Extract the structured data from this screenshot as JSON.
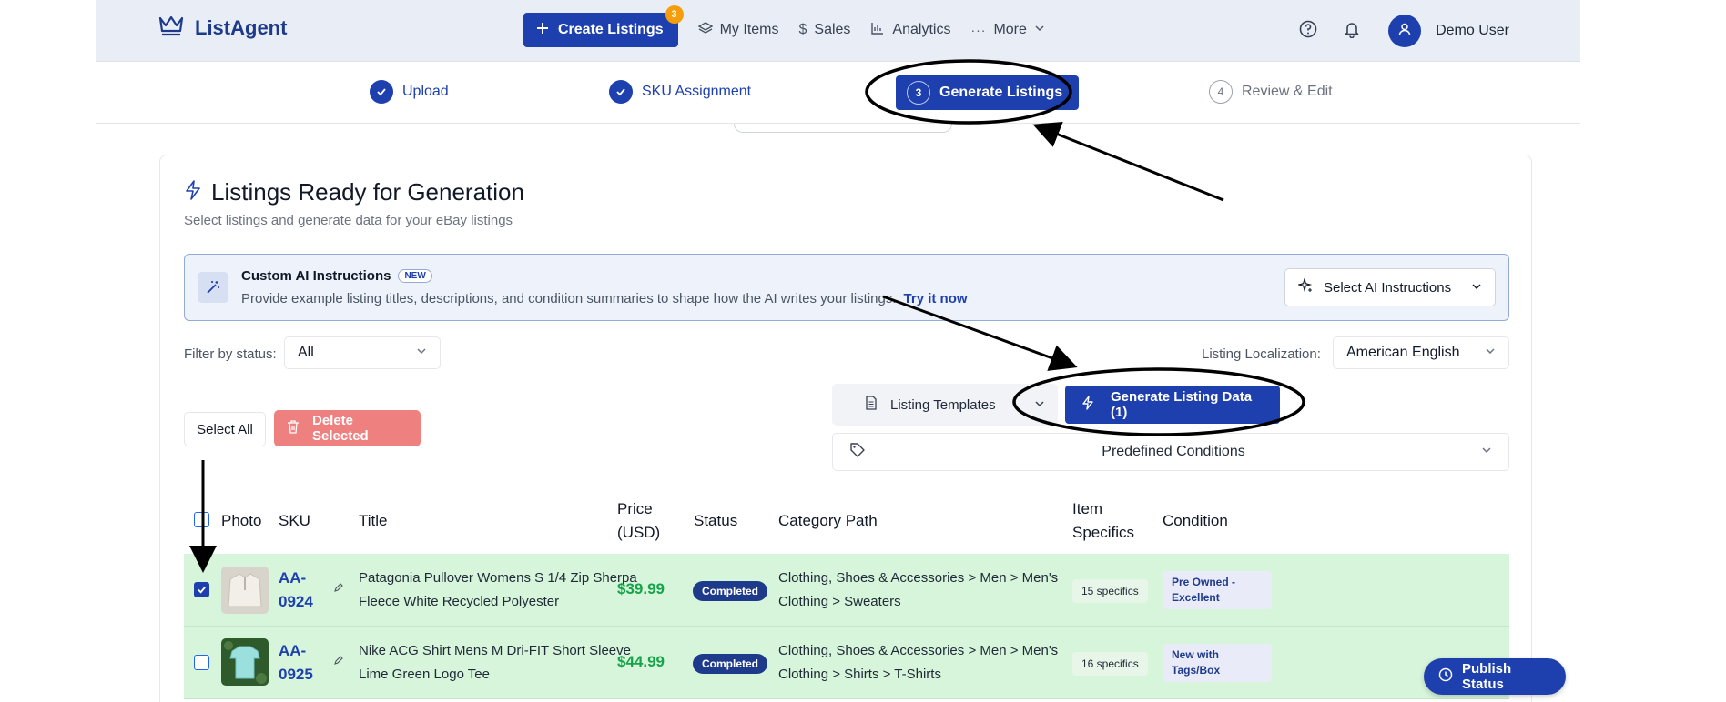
{
  "nav": {
    "brand": "ListAgent",
    "create_label": "Create Listings",
    "create_badge": "3",
    "links": [
      "My Items",
      "Sales",
      "Analytics",
      "More"
    ],
    "user": "Demo User"
  },
  "steps": [
    {
      "num": "",
      "label": "Upload",
      "state": "done"
    },
    {
      "num": "",
      "label": "SKU Assignment",
      "state": "done"
    },
    {
      "num": "3",
      "label": "Generate Listings",
      "state": "active"
    },
    {
      "num": "4",
      "label": "Review & Edit",
      "state": "todo"
    }
  ],
  "page": {
    "title": "Listings Ready for Generation",
    "subtitle": "Select listings and generate data for your eBay listings"
  },
  "ai": {
    "title": "Custom AI Instructions",
    "badge": "NEW",
    "description": "Provide example listing titles, descriptions, and condition summaries to shape how the AI writes your listings.",
    "try_link": "Try it now",
    "select_label": "Select AI Instructions"
  },
  "filters": {
    "status_label": "Filter by status:",
    "status_value": "All",
    "localization_label": "Listing Localization:",
    "localization_value": "American English"
  },
  "actions": {
    "select_all": "Select All",
    "delete_selected": "Delete Selected",
    "templates": "Listing Templates",
    "generate": "Generate Listing Data (1)",
    "conditions": "Predefined Conditions"
  },
  "table": {
    "headers": {
      "photo": "Photo",
      "sku": "SKU",
      "title": "Title",
      "price": "Price (USD)",
      "status": "Status",
      "category": "Category Path",
      "specifics": "Item Specifics",
      "condition": "Condition"
    },
    "rows": [
      {
        "checked": true,
        "sku": "AA-0924",
        "title": "Patagonia Pullover Womens S 1/4 Zip Sherpa Fleece White Recycled Polyester",
        "price": "$39.99",
        "status": "Completed",
        "category": "Clothing, Shoes & Accessories > Men > Men's Clothing > Sweaters",
        "specifics": "15 specifics",
        "condition": "Pre Owned - Excellent"
      },
      {
        "checked": false,
        "sku": "AA-0925",
        "title": "Nike ACG Shirt Mens M Dri-FIT Short Sleeve Lime Green Logo Tee",
        "price": "$44.99",
        "status": "Completed",
        "category": "Clothing, Shoes & Accessories > Men > Men's Clothing > Shirts > T-Shirts",
        "specifics": "16 specifics",
        "condition": "New with Tags/Box"
      }
    ]
  },
  "publish": "Publish Status",
  "colors": {
    "primary": "#1e40af",
    "row_bg": "#d6f5da",
    "price": "#16a34a",
    "delete": "#ef8080"
  }
}
